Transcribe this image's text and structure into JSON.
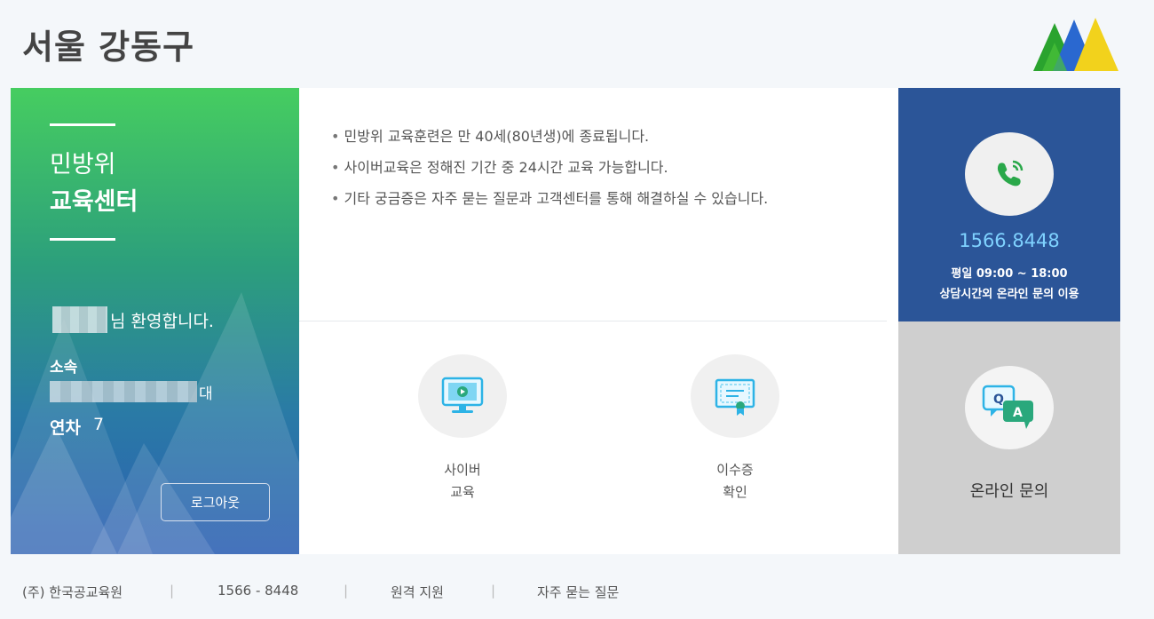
{
  "header": {
    "title": "서울 강동구",
    "logo_icon": "mountain-logo-icon"
  },
  "left_panel": {
    "title_line1": "민방위",
    "title_line2": "교육센터",
    "welcome_suffix": "님 환영합니다.",
    "affiliation_label": "소속",
    "affiliation_suffix": "대",
    "year_label": "연차",
    "year_value": "7",
    "logout_label": "로그아웃"
  },
  "notices": [
    "민방위 교육훈련은 만 40세(80년생)에 종료됩니다.",
    "사이버교육은 정해진 기간 중 24시간 교육 가능합니다.",
    "기타 궁금증은 자주 묻는 질문과 고객센터를 통해 해결하실 수 있습니다."
  ],
  "services": {
    "cyber": {
      "line1": "사이버",
      "line2": "교육",
      "icon": "monitor-play-icon"
    },
    "certificate": {
      "line1": "이수증",
      "line2": "확인",
      "icon": "certificate-icon"
    }
  },
  "call_center": {
    "number": "1566.8448",
    "hours": "평일 09:00 ~ 18:00",
    "note": "상담시간외 온라인 문의 이용",
    "icon": "phone-icon"
  },
  "online_inquiry": {
    "label": "온라인 문의",
    "icon": "qa-chat-icon"
  },
  "footer": {
    "company": "(주) 한국공교육원",
    "phone": "1566 - 8448",
    "remote": "원격 지원",
    "faq": "자주 묻는 질문",
    "separator": "|"
  },
  "colors": {
    "green_start": "#46cd60",
    "blue_end": "#2c5fb3",
    "call_bg": "#2b5598",
    "call_number": "#7fd2ff",
    "qa_bg": "#cfcfcf"
  }
}
